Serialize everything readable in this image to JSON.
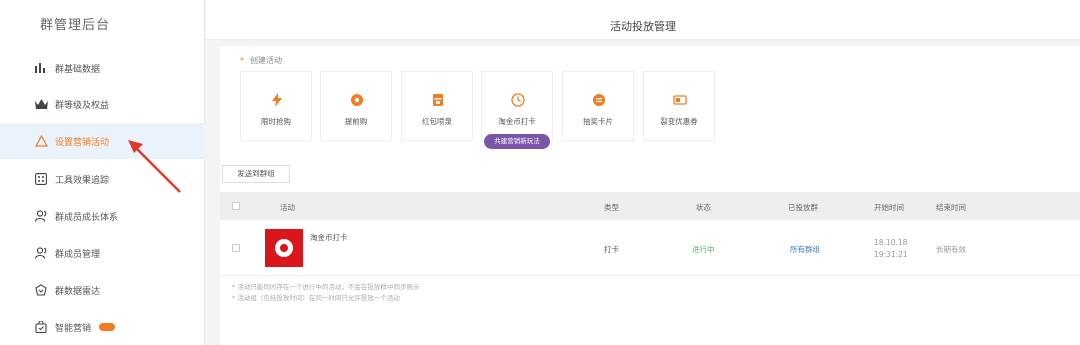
{
  "sidebar": {
    "title": "群管理后台",
    "items": [
      {
        "label": "群基础数据",
        "icon": "bar-chart-icon"
      },
      {
        "label": "群等级及权益",
        "icon": "crown-icon"
      },
      {
        "label": "设置营销活动",
        "icon": "triangle-icon",
        "active": true
      },
      {
        "label": "工具效果追踪",
        "icon": "dice-icon"
      },
      {
        "label": "群成员成长体系",
        "icon": "users-icon"
      },
      {
        "label": "群成员管理",
        "icon": "user-icon"
      },
      {
        "label": "群数据雷达",
        "icon": "radar-icon"
      },
      {
        "label": "智能营销",
        "icon": "bag-icon",
        "badge": true
      }
    ]
  },
  "header": {
    "title": "活动投放管理"
  },
  "create": {
    "label": "创建活动",
    "tiles": [
      {
        "label": "限时抢购",
        "icon": "lightning-icon"
      },
      {
        "label": "提前购",
        "icon": "coin-icon"
      },
      {
        "label": "红包喷泉",
        "icon": "redpacket-icon"
      },
      {
        "label": "淘金币打卡",
        "icon": "clock-icon"
      },
      {
        "label": "抽奖卡片",
        "icon": "lottery-icon"
      },
      {
        "label": "裂变优惠券",
        "icon": "coupon-icon"
      }
    ],
    "tag": "共建营销新玩法"
  },
  "send_button": "发送到群组",
  "table": {
    "headers": [
      "活动",
      "类型",
      "状态",
      "已投放群",
      "开始时间",
      "结束时间"
    ],
    "rows": [
      {
        "name": "淘金币打卡",
        "type": "打卡",
        "status": "进行中",
        "groups": "所有群组",
        "start_date": "18.10.18",
        "start_time": "19:31:21",
        "end": "长期有效"
      }
    ]
  },
  "notes": [
    "* 活动只能同时存在一个进行中的活动，不会在投放群中同步展示",
    "* 活动组（包括投放时间）在同一时间只允许投放一个活动"
  ],
  "colors": {
    "accent": "#f47b20",
    "tag": "#7b55a8",
    "thumb": "#d8161b",
    "arrow": "#e0392b"
  }
}
